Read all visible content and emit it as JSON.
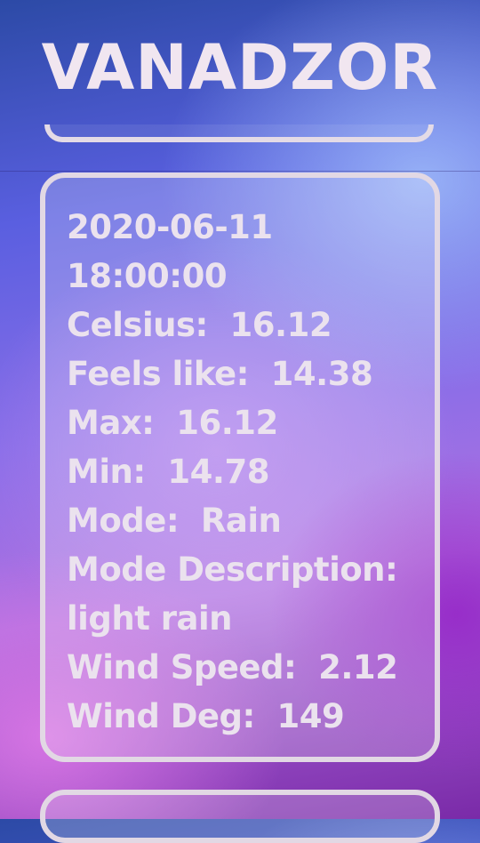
{
  "header": {
    "city": "VANADZOR"
  },
  "forecast": {
    "date": "2020-06-11",
    "time": "18:00:00",
    "lines": [
      "Celsius:  16.12",
      "Feels like:  14.38",
      "Max:  16.12",
      "Min:  14.78",
      "Mode:  Rain",
      "Mode Description:",
      "light rain",
      "Wind Speed:  2.12",
      "Wind Deg:  149"
    ]
  }
}
